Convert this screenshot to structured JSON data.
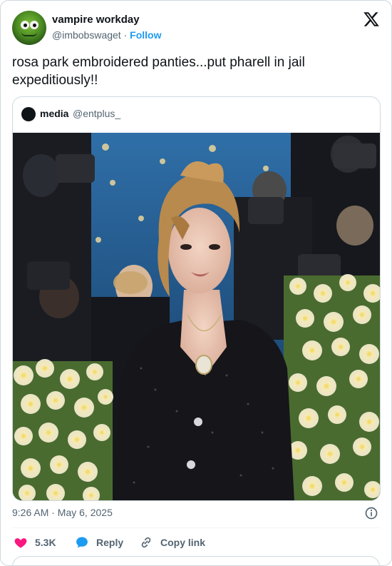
{
  "author": {
    "name": "vampire workday",
    "handle": "@imbobswaget",
    "separator": "·",
    "follow_label": "Follow",
    "avatar_icon": "kermit-frog-avatar"
  },
  "tweet": {
    "text": "rosa park embroidered panties...put pharell in jail expeditiously!!"
  },
  "quoted": {
    "name": "media",
    "handle": "@entplus_",
    "media_description_icon": "photo"
  },
  "meta": {
    "timestamp": "9:26 AM · May 6, 2025"
  },
  "actions": {
    "like_count": "5.3K",
    "reply_label": "Reply",
    "copy_label": "Copy link"
  },
  "colors": {
    "accent": "#1d9bf0",
    "like": "#f91880",
    "text_secondary": "#536471",
    "border": "#cfd9de"
  }
}
